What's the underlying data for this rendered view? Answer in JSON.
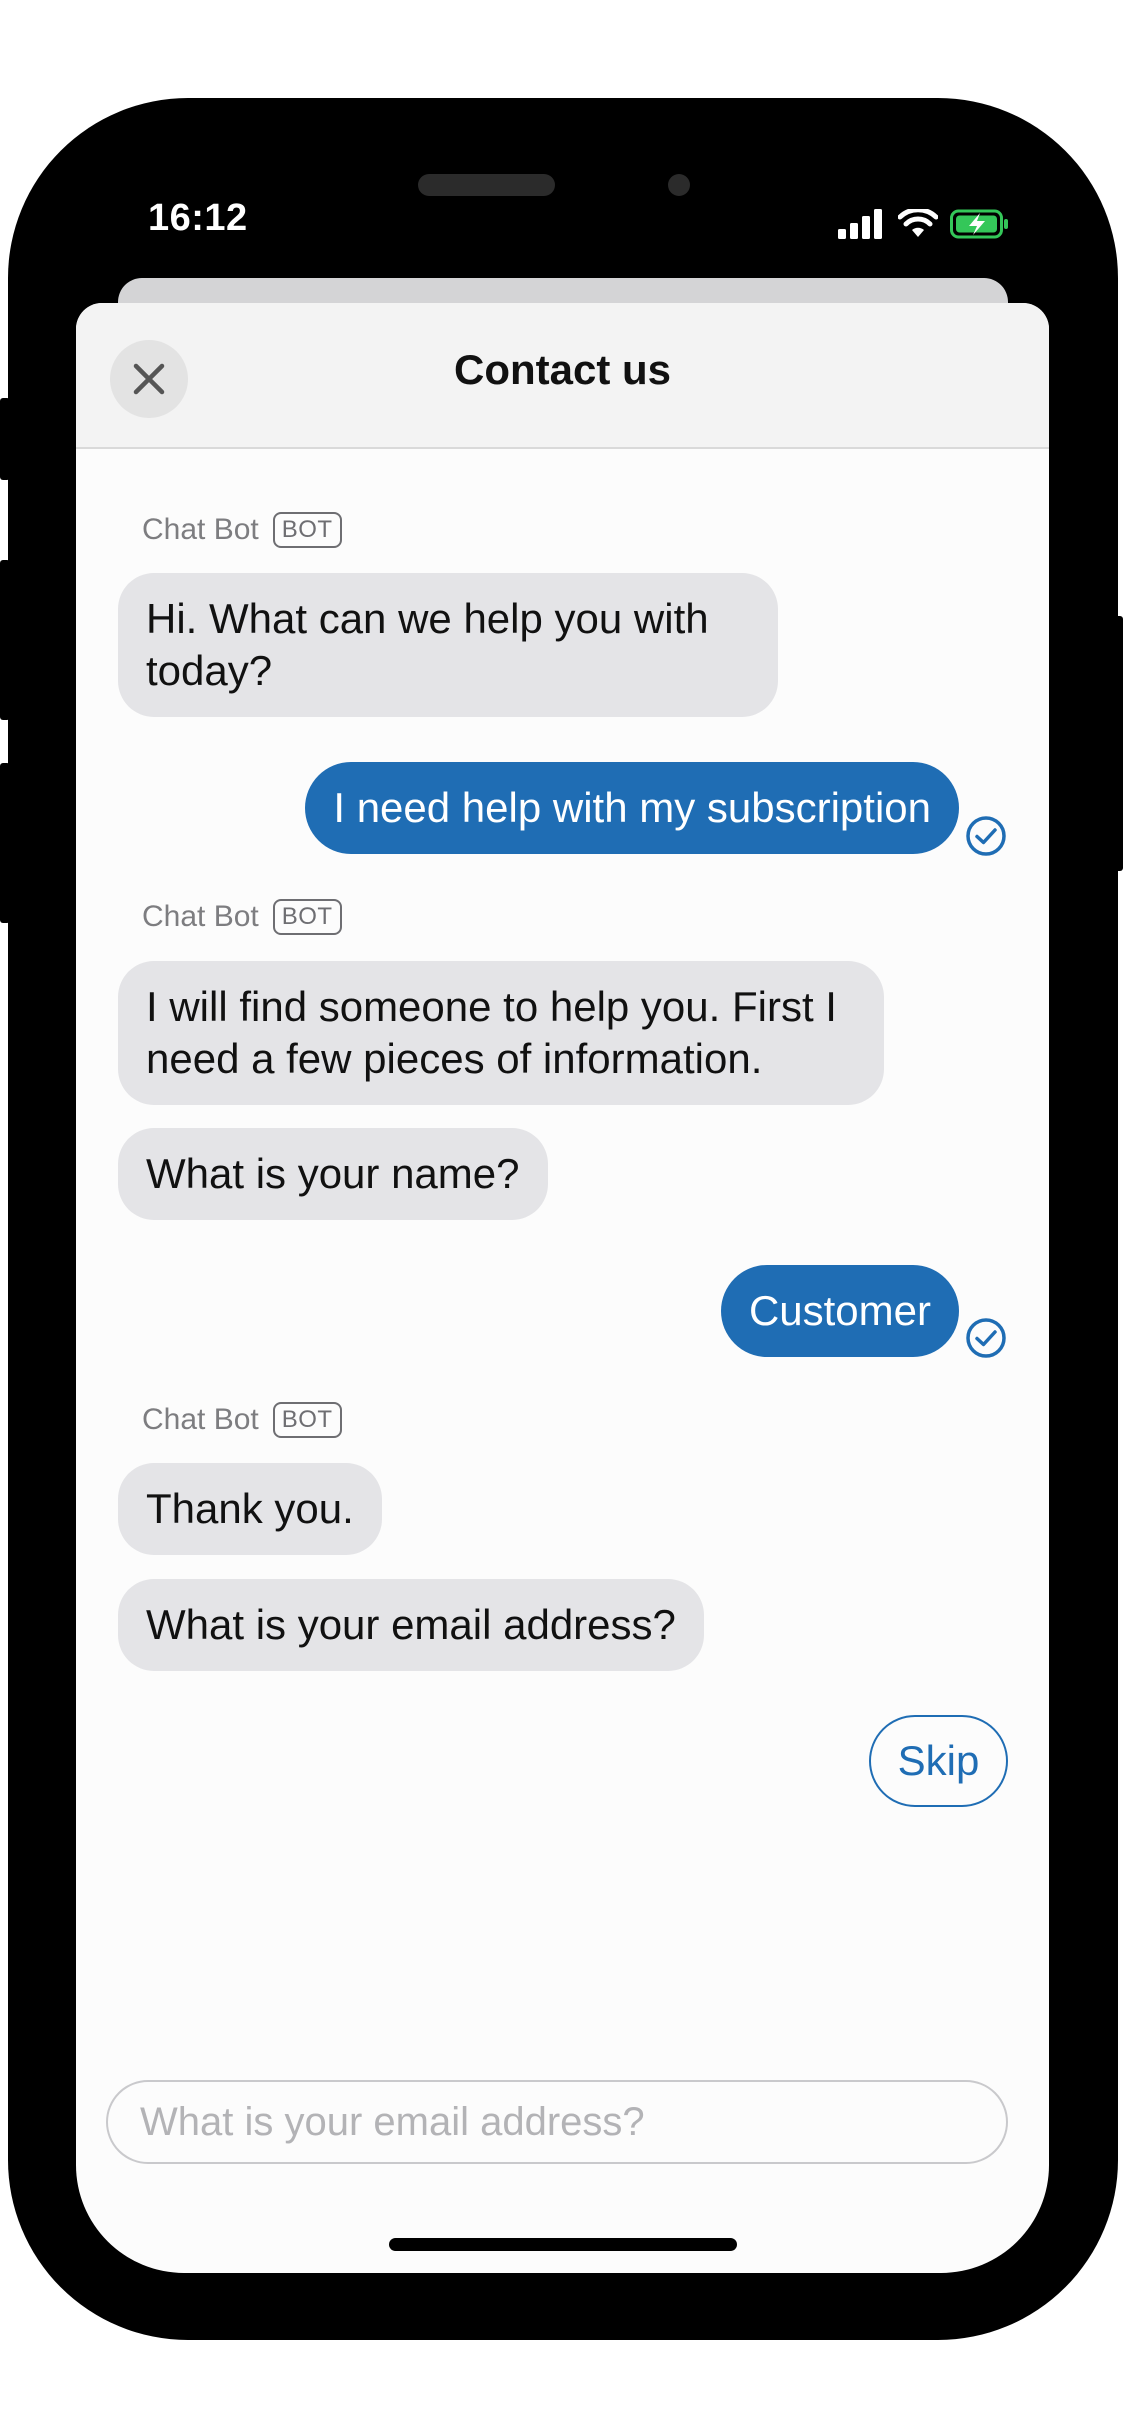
{
  "status_bar": {
    "time": "16:12",
    "icons": [
      "cellular-signal-icon",
      "wifi-icon",
      "battery-charging-icon"
    ],
    "battery_color": "#34c759"
  },
  "header": {
    "title": "Contact us",
    "close_icon": "close-icon"
  },
  "colors": {
    "accent": "#1f6db4",
    "bot_bubble": "#e4e4e7",
    "header_bg": "#f3f3f3"
  },
  "messages": [
    {
      "sender": "Chat Bot",
      "badge": "BOT"
    },
    {
      "text": "Hi. What can we help you with today?"
    },
    {
      "text": "I need help with my subscription",
      "status_icon": "check-circle-icon"
    },
    {
      "sender": "Chat Bot",
      "badge": "BOT"
    },
    {
      "text": "I will find someone to help you. First I need a few pieces of information."
    },
    {
      "text": "What is your name?"
    },
    {
      "text": "Customer",
      "status_icon": "check-circle-icon"
    },
    {
      "sender": "Chat Bot",
      "badge": "BOT"
    },
    {
      "text": "Thank you."
    },
    {
      "text": "What is your email address?"
    }
  ],
  "skip_label": "Skip",
  "input": {
    "value": "",
    "placeholder": "What is your email address?"
  }
}
